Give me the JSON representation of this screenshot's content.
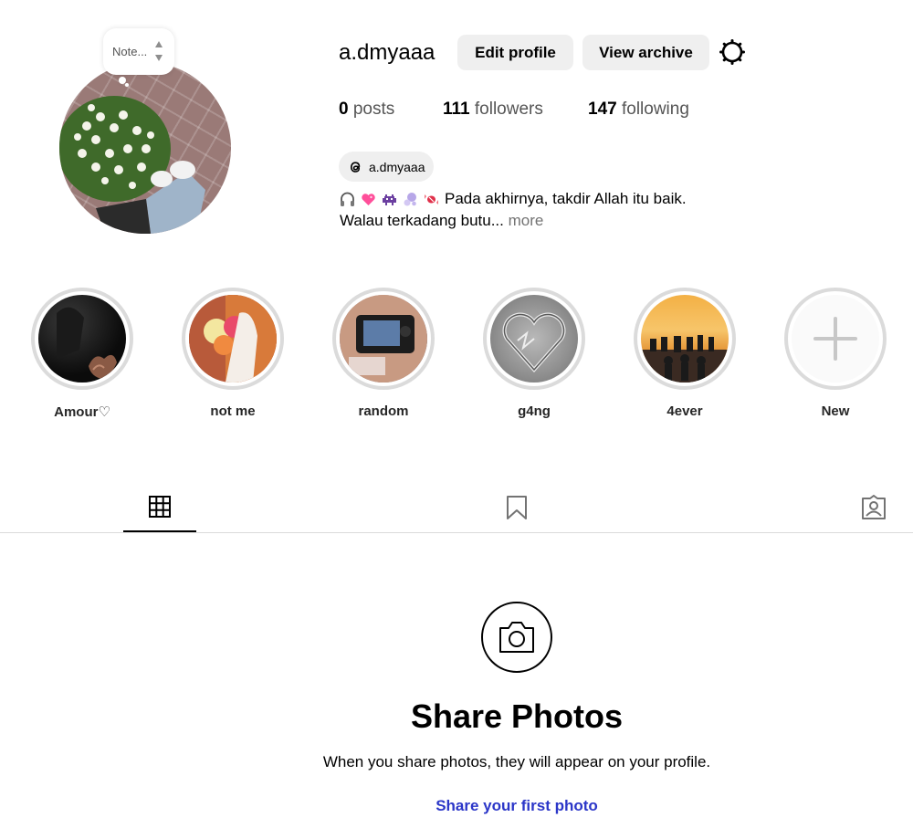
{
  "profile": {
    "note_text": "Note...",
    "username": "a.dmyaaa",
    "edit_profile_label": "Edit profile",
    "view_archive_label": "View archive",
    "stats": {
      "posts_count": "0",
      "posts_label": "posts",
      "followers_count": "111",
      "followers_label": "followers",
      "following_count": "147",
      "following_label": "following"
    },
    "threads_handle": "a.dmyaaa",
    "bio_text": "Pada akhirnya, takdir Allah itu baik.",
    "bio_line2": "Walau terkadang butu...",
    "bio_more": "more",
    "bio_emojis": [
      "headphones-emoji",
      "pink-heart-emoji",
      "alien-monster-emoji",
      "bubbles-emoji",
      "candy-emoji"
    ]
  },
  "highlights": [
    {
      "label": "Amour♡"
    },
    {
      "label": "not me"
    },
    {
      "label": "random"
    },
    {
      "label": "g4ng"
    },
    {
      "label": "4ever"
    },
    {
      "label": "New"
    }
  ],
  "tabs": [
    "grid-icon",
    "bookmark-icon",
    "tagged-icon"
  ],
  "empty_state": {
    "title": "Share Photos",
    "subtitle": "When you share photos, they will appear on your profile.",
    "link": "Share your first photo"
  },
  "colors": {
    "button_bg": "#efefef",
    "link_blue": "#2b36c8",
    "muted_text": "#737373",
    "highlight_ring": "#dbdbdb"
  }
}
